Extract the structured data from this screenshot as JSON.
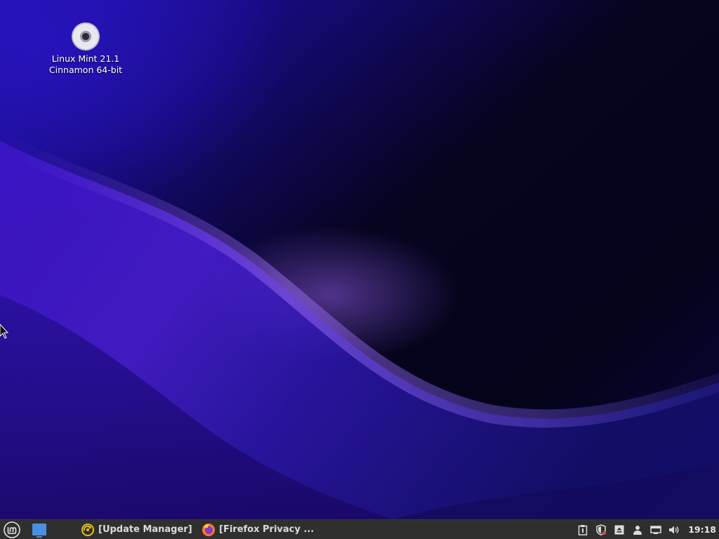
{
  "desktop": {
    "icons": [
      {
        "label_line1": "Linux Mint 21.1",
        "label_line2": "Cinnamon 64-bit",
        "icon": "optical-disc-icon"
      }
    ]
  },
  "panel": {
    "menu_icon": "mint-logo-icon",
    "show_desktop_icon": "show-desktop-icon",
    "tasks": [
      {
        "label": "[Update Manager]",
        "icon": "update-manager-icon"
      },
      {
        "label": "[Firefox Privacy ...",
        "icon": "firefox-icon"
      }
    ],
    "tray_icons": [
      "clipboard-icon",
      "shield-icon",
      "removable-drive-icon",
      "user-icon",
      "network-icon",
      "volume-icon"
    ],
    "clock": "19:18"
  },
  "colors": {
    "panel_bg": "#2f2f2f",
    "accent_blue": "#4a90e2",
    "update_yellow": "#e8c21a"
  }
}
